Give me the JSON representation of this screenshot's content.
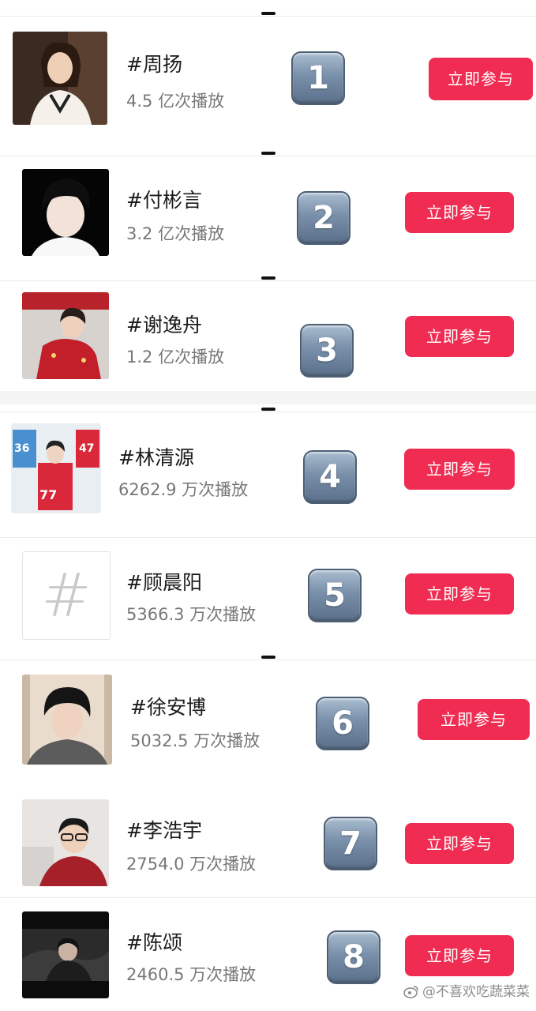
{
  "items": [
    {
      "rank": "1",
      "title": "#周扬",
      "plays": "4.5 亿次播放",
      "button": "立即参与"
    },
    {
      "rank": "2",
      "title": "#付彬言",
      "plays": "3.2 亿次播放",
      "button": "立即参与"
    },
    {
      "rank": "3",
      "title": "#谢逸舟",
      "plays": "1.2 亿次播放",
      "button": "立即参与"
    },
    {
      "rank": "4",
      "title": "#林清源",
      "plays": "6262.9 万次播放",
      "button": "立即参与"
    },
    {
      "rank": "5",
      "title": "#顾晨阳",
      "plays": "5366.3 万次播放",
      "button": "立即参与"
    },
    {
      "rank": "6",
      "title": "#徐安博",
      "plays": "5032.5 万次播放",
      "button": "立即参与"
    },
    {
      "rank": "7",
      "title": "#李浩宇",
      "plays": "2754.0 万次播放",
      "button": "立即参与"
    },
    {
      "rank": "8",
      "title": "#陈颂",
      "plays": "2460.5 万次播放",
      "button": "立即参与"
    }
  ],
  "placeholder_glyph": "#",
  "watermark": "@不喜欢吃蔬菜菜",
  "colors": {
    "accent": "#f02c52",
    "rank_badge": "#6f86a0",
    "plays_text": "#777777"
  }
}
